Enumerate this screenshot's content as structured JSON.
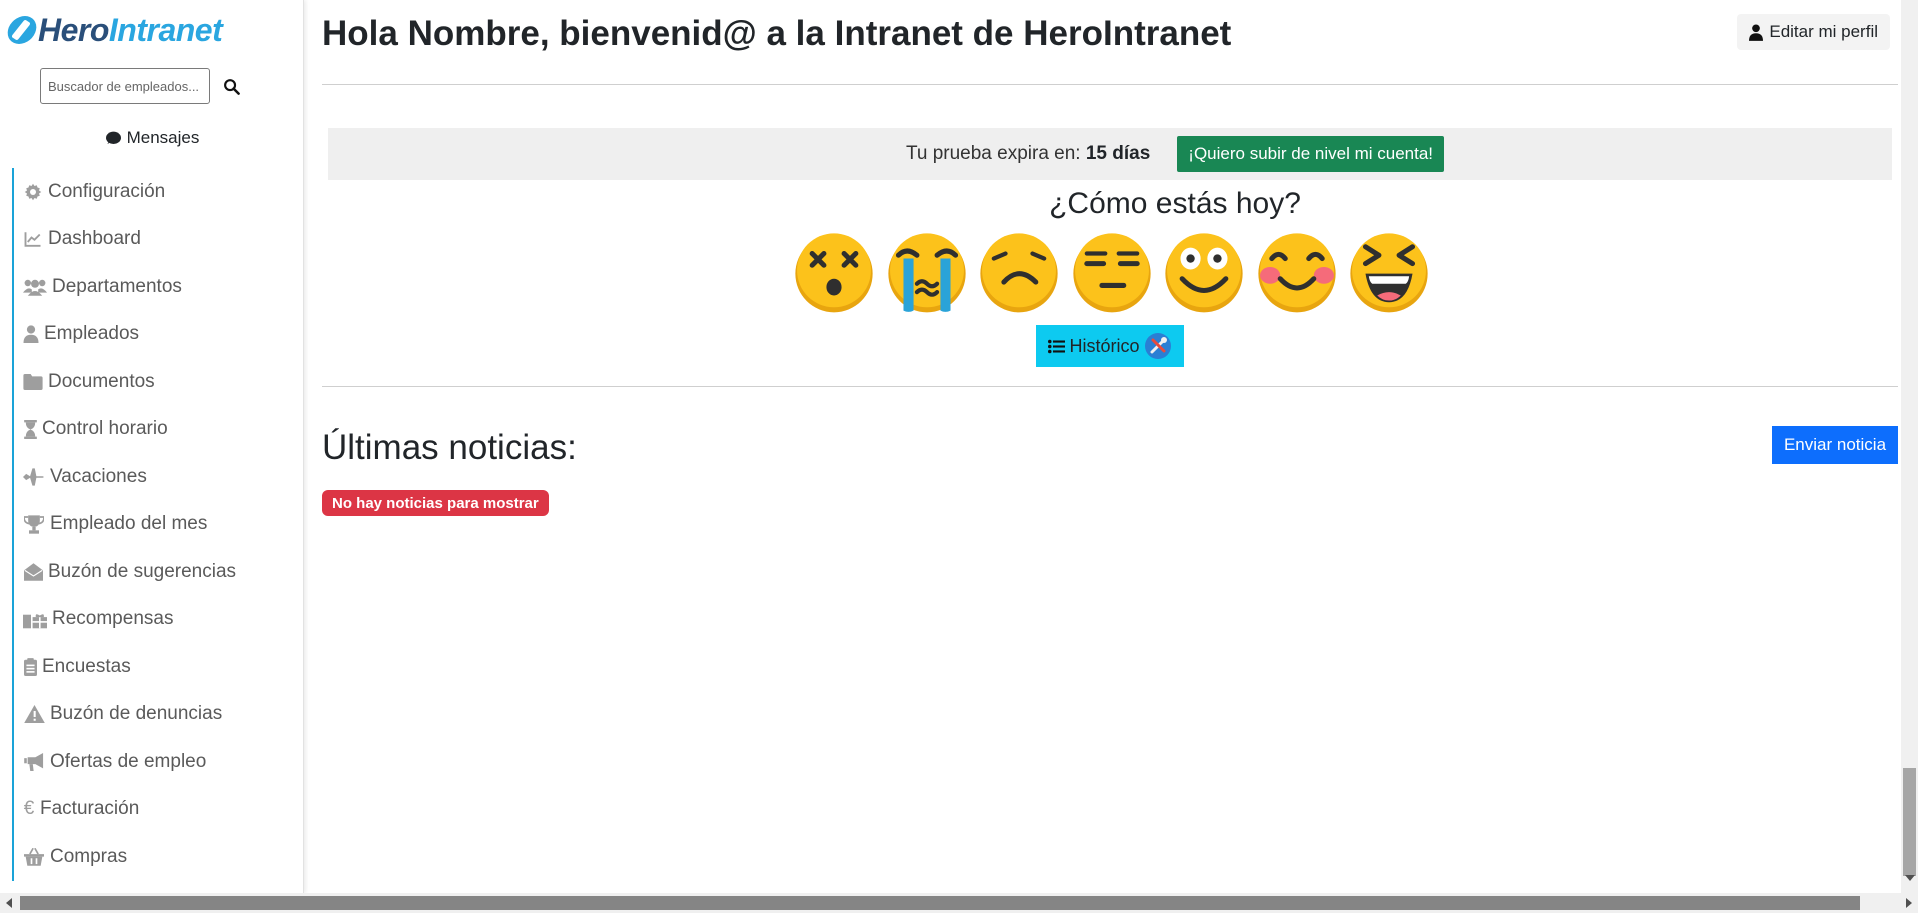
{
  "logo": {
    "part1": "Hero",
    "part2": "Intranet"
  },
  "search": {
    "placeholder": "Buscador de empleados..."
  },
  "messages": {
    "label": "Mensajes"
  },
  "sidebar": {
    "items": [
      {
        "label": "Configuración",
        "icon": "gear-icon"
      },
      {
        "label": "Dashboard",
        "icon": "chart-line-icon"
      },
      {
        "label": "Departamentos",
        "icon": "users-icon"
      },
      {
        "label": "Empleados",
        "icon": "user-icon"
      },
      {
        "label": "Documentos",
        "icon": "folder-icon"
      },
      {
        "label": "Control horario",
        "icon": "hourglass-icon"
      },
      {
        "label": "Vacaciones",
        "icon": "plane-icon"
      },
      {
        "label": "Empleado del mes",
        "icon": "trophy-icon"
      },
      {
        "label": "Buzón de sugerencias",
        "icon": "envelope-open-icon"
      },
      {
        "label": "Recompensas",
        "icon": "gifts-icon"
      },
      {
        "label": "Encuestas",
        "icon": "clipboard-icon"
      },
      {
        "label": "Buzón de denuncias",
        "icon": "warning-icon"
      },
      {
        "label": "Ofertas de empleo",
        "icon": "bullhorn-icon"
      },
      {
        "label": "Facturación",
        "icon": "euro-icon"
      },
      {
        "label": "Compras",
        "icon": "basket-icon"
      }
    ]
  },
  "header": {
    "greeting_prefix": "Hola ",
    "user_name": "Nombre",
    "greeting_middle": ", bienvenid@ a la Intranet de ",
    "company": "HeroIntranet",
    "edit_profile": "Editar mi perfil"
  },
  "trial": {
    "text": "Tu prueba expira en: ",
    "days": "15 días",
    "upgrade_label": "¡Quiero subir de nivel mi cuenta!"
  },
  "mood": {
    "title": "¿Cómo estás hoy?",
    "options": [
      "dizzy-face-icon",
      "crying-face-icon",
      "frowning-face-icon",
      "expressionless-face-icon",
      "smiling-face-icon",
      "blushing-face-icon",
      "laughing-face-icon"
    ]
  },
  "history": {
    "label": "Histórico"
  },
  "news": {
    "title": "Últimas noticias:",
    "send_label": "Enviar noticia",
    "empty_label": "No hay noticias para mostrar"
  },
  "colors": {
    "accent": "#1aa3d8",
    "upgrade": "#198754",
    "history": "#0dcaf0",
    "send": "#0d6efd",
    "empty": "#dc3545",
    "emoji": "#fcc21b"
  }
}
